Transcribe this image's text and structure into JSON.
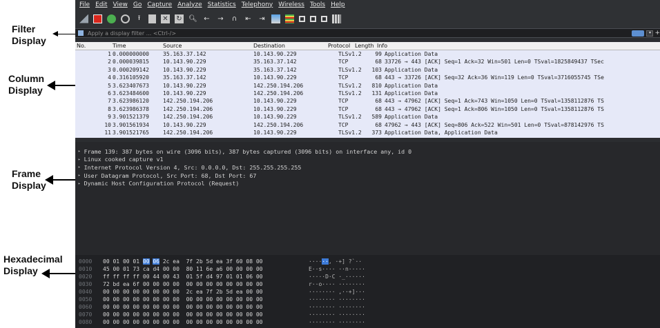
{
  "annotations": {
    "filter": [
      "Filter",
      "Display"
    ],
    "column": [
      "Column",
      "Display"
    ],
    "frame": [
      "Frame",
      "Display"
    ],
    "hex": [
      "Hexadecimal",
      "Display"
    ]
  },
  "menu": [
    "File",
    "Edit",
    "View",
    "Go",
    "Capture",
    "Analyze",
    "Statistics",
    "Telephony",
    "Wireless",
    "Tools",
    "Help"
  ],
  "toolbar": {
    "icons": [
      "shark-fin-icon",
      "stop-capture-icon",
      "restart-capture-icon",
      "capture-options-icon",
      "open-file-icon",
      "save-file-icon",
      "close-file-icon",
      "reload-icon",
      "find-packet-icon",
      "go-back-icon",
      "go-forward-icon",
      "go-to-packet-icon",
      "first-packet-icon",
      "last-packet-icon",
      "autoscroll-icon",
      "colorize-icon",
      "zoom-in-icon",
      "zoom-out-icon",
      "normal-size-icon",
      "resize-columns-icon"
    ]
  },
  "filter": {
    "placeholder": "Apply a display filter ... <Ctrl-/>",
    "plus": "+"
  },
  "packet_list": {
    "columns": [
      "No.",
      "Time",
      "Source",
      "Destination",
      "Protocol",
      "Length",
      "Info"
    ],
    "rows": [
      {
        "no": "1",
        "time": "0.000000000",
        "src": "35.163.37.142",
        "dst": "10.143.90.229",
        "proto": "TLSv1.2",
        "len": "99",
        "info": "Application Data"
      },
      {
        "no": "2",
        "time": "0.000039815",
        "src": "10.143.90.229",
        "dst": "35.163.37.142",
        "proto": "TCP",
        "len": "68",
        "info": "33726 → 443 [ACK] Seq=1 Ack=32 Win=501 Len=0 TSval=1825849437 TSec"
      },
      {
        "no": "3",
        "time": "0.000209142",
        "src": "10.143.90.229",
        "dst": "35.163.37.142",
        "proto": "TLSv1.2",
        "len": "103",
        "info": "Application Data"
      },
      {
        "no": "4",
        "time": "0.316105920",
        "src": "35.163.37.142",
        "dst": "10.143.90.229",
        "proto": "TCP",
        "len": "68",
        "info": "443 → 33726 [ACK] Seq=32 Ack=36 Win=119 Len=0 TSval=3716055745 TSe"
      },
      {
        "no": "5",
        "time": "3.623407673",
        "src": "10.143.90.229",
        "dst": "142.250.194.206",
        "proto": "TLSv1.2",
        "len": "810",
        "info": "Application Data"
      },
      {
        "no": "6",
        "time": "3.623484600",
        "src": "10.143.90.229",
        "dst": "142.250.194.206",
        "proto": "TLSv1.2",
        "len": "131",
        "info": "Application Data"
      },
      {
        "no": "7",
        "time": "3.623986120",
        "src": "142.250.194.206",
        "dst": "10.143.90.229",
        "proto": "TCP",
        "len": "68",
        "info": "443 → 47962 [ACK] Seq=1 Ack=743 Win=1050 Len=0 TSval=1358112876 TS"
      },
      {
        "no": "8",
        "time": "3.623986378",
        "src": "142.250.194.206",
        "dst": "10.143.90.229",
        "proto": "TCP",
        "len": "68",
        "info": "443 → 47962 [ACK] Seq=1 Ack=806 Win=1050 Len=0 TSval=1358112876 TS"
      },
      {
        "no": "9",
        "time": "3.901521379",
        "src": "142.250.194.206",
        "dst": "10.143.90.229",
        "proto": "TLSv1.2",
        "len": "589",
        "info": "Application Data"
      },
      {
        "no": "10",
        "time": "3.901561934",
        "src": "10.143.90.229",
        "dst": "142.250.194.206",
        "proto": "TCP",
        "len": "68",
        "info": "47962 → 443 [ACK] Seq=806 Ack=522 Win=501 Len=0 TSval=878142976 TS"
      },
      {
        "no": "11",
        "time": "3.901521765",
        "src": "142.250.194.206",
        "dst": "10.143.90.229",
        "proto": "TLSv1.2",
        "len": "373",
        "info": "Application Data, Application Data"
      }
    ]
  },
  "details": [
    "Frame 139: 387 bytes on wire (3096 bits), 387 bytes captured (3096 bits) on interface any, id 0",
    "Linux cooked capture v1",
    "Internet Protocol Version 4, Src: 0.0.0.0, Dst: 255.255.255.255",
    "User Datagram Protocol, Src Port: 68, Dst Port: 67",
    "Dynamic Host Configuration Protocol (Request)"
  ],
  "hex": [
    {
      "offset": "0000",
      "bytes": [
        "00",
        "01",
        "00",
        "01",
        "00",
        "06",
        "2c",
        "ea",
        "7f",
        "2b",
        "5d",
        "ea",
        "3f",
        "60",
        "08",
        "00"
      ],
      "hl": [
        4,
        5
      ],
      "ascii": "····",
      "ascii_hl": "··",
      "ascii_rest": ", ·+] ?`··"
    },
    {
      "offset": "0010",
      "bytes": [
        "45",
        "00",
        "01",
        "73",
        "ca",
        "d4",
        "00",
        "00",
        "80",
        "11",
        "6e",
        "a6",
        "00",
        "00",
        "00",
        "00"
      ],
      "hl": [],
      "ascii": "E··s···· ··n·····",
      "ascii_hl": "",
      "ascii_rest": ""
    },
    {
      "offset": "0020",
      "bytes": [
        "ff",
        "ff",
        "ff",
        "ff",
        "00",
        "44",
        "00",
        "43",
        "01",
        "5f",
        "d4",
        "97",
        "01",
        "01",
        "06",
        "00"
      ],
      "hl": [],
      "ascii": "·····D·C ·_······",
      "ascii_hl": "",
      "ascii_rest": ""
    },
    {
      "offset": "0030",
      "bytes": [
        "72",
        "bd",
        "ea",
        "6f",
        "00",
        "00",
        "00",
        "00",
        "00",
        "00",
        "00",
        "00",
        "00",
        "00",
        "00",
        "00"
      ],
      "hl": [],
      "ascii": "r··o···· ········",
      "ascii_hl": "",
      "ascii_rest": ""
    },
    {
      "offset": "0040",
      "bytes": [
        "00",
        "00",
        "00",
        "00",
        "00",
        "00",
        "00",
        "00",
        "2c",
        "ea",
        "7f",
        "2b",
        "5d",
        "ea",
        "00",
        "00"
      ],
      "hl": [],
      "ascii": "········ ,··+]···",
      "ascii_hl": "",
      "ascii_rest": ""
    },
    {
      "offset": "0050",
      "bytes": [
        "00",
        "00",
        "00",
        "00",
        "00",
        "00",
        "00",
        "00",
        "00",
        "00",
        "00",
        "00",
        "00",
        "00",
        "00",
        "00"
      ],
      "hl": [],
      "ascii": "········ ········",
      "ascii_hl": "",
      "ascii_rest": ""
    },
    {
      "offset": "0060",
      "bytes": [
        "00",
        "00",
        "00",
        "00",
        "00",
        "00",
        "00",
        "00",
        "00",
        "00",
        "00",
        "00",
        "00",
        "00",
        "00",
        "00"
      ],
      "hl": [],
      "ascii": "········ ········",
      "ascii_hl": "",
      "ascii_rest": ""
    },
    {
      "offset": "0070",
      "bytes": [
        "00",
        "00",
        "00",
        "00",
        "00",
        "00",
        "00",
        "00",
        "00",
        "00",
        "00",
        "00",
        "00",
        "00",
        "00",
        "00"
      ],
      "hl": [],
      "ascii": "········ ········",
      "ascii_hl": "",
      "ascii_rest": ""
    },
    {
      "offset": "0080",
      "bytes": [
        "00",
        "00",
        "00",
        "00",
        "00",
        "00",
        "00",
        "00",
        "00",
        "00",
        "00",
        "00",
        "00",
        "00",
        "00",
        "00"
      ],
      "hl": [],
      "ascii": "········ ········",
      "ascii_hl": "",
      "ascii_rest": ""
    }
  ],
  "colors": {
    "packet_row_bg": "#e6e9f8",
    "highlight": "#3d7bd8",
    "stop_red": "#d9261c",
    "restart_green": "#4caf50"
  }
}
